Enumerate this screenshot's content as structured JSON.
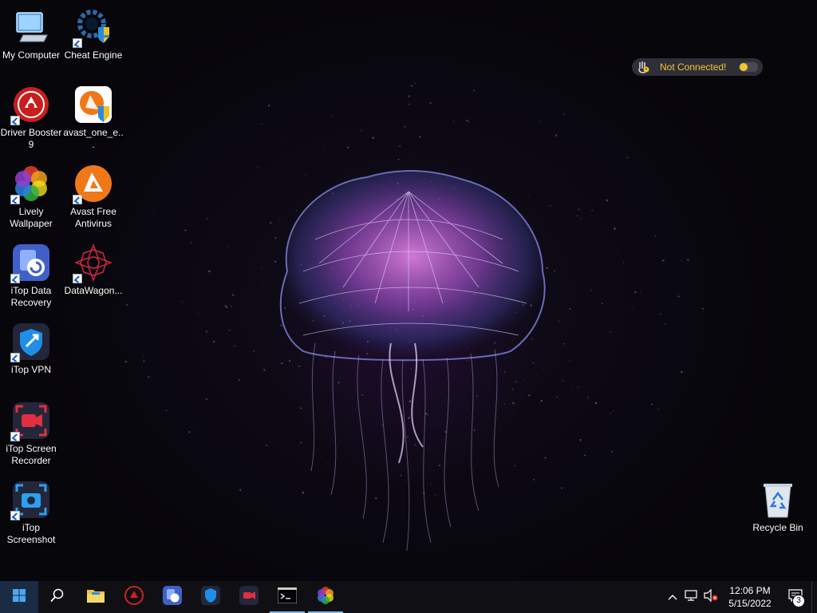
{
  "desktop": {
    "icons": [
      {
        "label": "My Computer",
        "icon": "computer-icon"
      },
      {
        "label": "Cheat Engine",
        "icon": "cheat-engine-icon"
      },
      {
        "label": "Driver Booster 9",
        "icon": "driver-booster-icon"
      },
      {
        "label": "avast_one_e...",
        "icon": "avast-one-installer-icon"
      },
      {
        "label": "Lively Wallpaper",
        "icon": "lively-wallpaper-icon"
      },
      {
        "label": "Avast Free Antivirus",
        "icon": "avast-icon"
      },
      {
        "label": "iTop Data Recovery",
        "icon": "itop-data-recovery-icon"
      },
      {
        "label": "DataWagon...",
        "icon": "datawagon-icon"
      },
      {
        "label": "iTop VPN",
        "icon": "itop-vpn-icon"
      },
      {
        "label": "iTop Screen Recorder",
        "icon": "itop-screen-recorder-icon"
      },
      {
        "label": "iTop Screenshot",
        "icon": "itop-screenshot-icon"
      },
      {
        "label": "Recycle Bin",
        "icon": "recycle-bin-icon"
      }
    ],
    "vpn_widget": {
      "status_text": "Not Connected!",
      "status_color": "#f4c430"
    }
  },
  "taskbar": {
    "pinned": [
      {
        "name": "search",
        "icon": "search-icon"
      },
      {
        "name": "file-explorer",
        "icon": "folder-icon"
      },
      {
        "name": "driver-booster",
        "icon": "driver-booster-icon"
      },
      {
        "name": "itop-data-recovery",
        "icon": "itop-data-recovery-icon"
      },
      {
        "name": "itop-vpn",
        "icon": "itop-vpn-icon"
      },
      {
        "name": "itop-screen-recorder",
        "icon": "itop-screen-recorder-icon"
      },
      {
        "name": "terminal",
        "icon": "terminal-icon"
      },
      {
        "name": "lively-wallpaper",
        "icon": "lively-wallpaper-icon"
      }
    ],
    "active_apps": [
      "terminal",
      "lively-wallpaper"
    ],
    "clock": {
      "time": "12:06 PM",
      "date": "5/15/2022"
    },
    "notifications": {
      "count": "3"
    },
    "accent_color": "#76b9ed"
  }
}
